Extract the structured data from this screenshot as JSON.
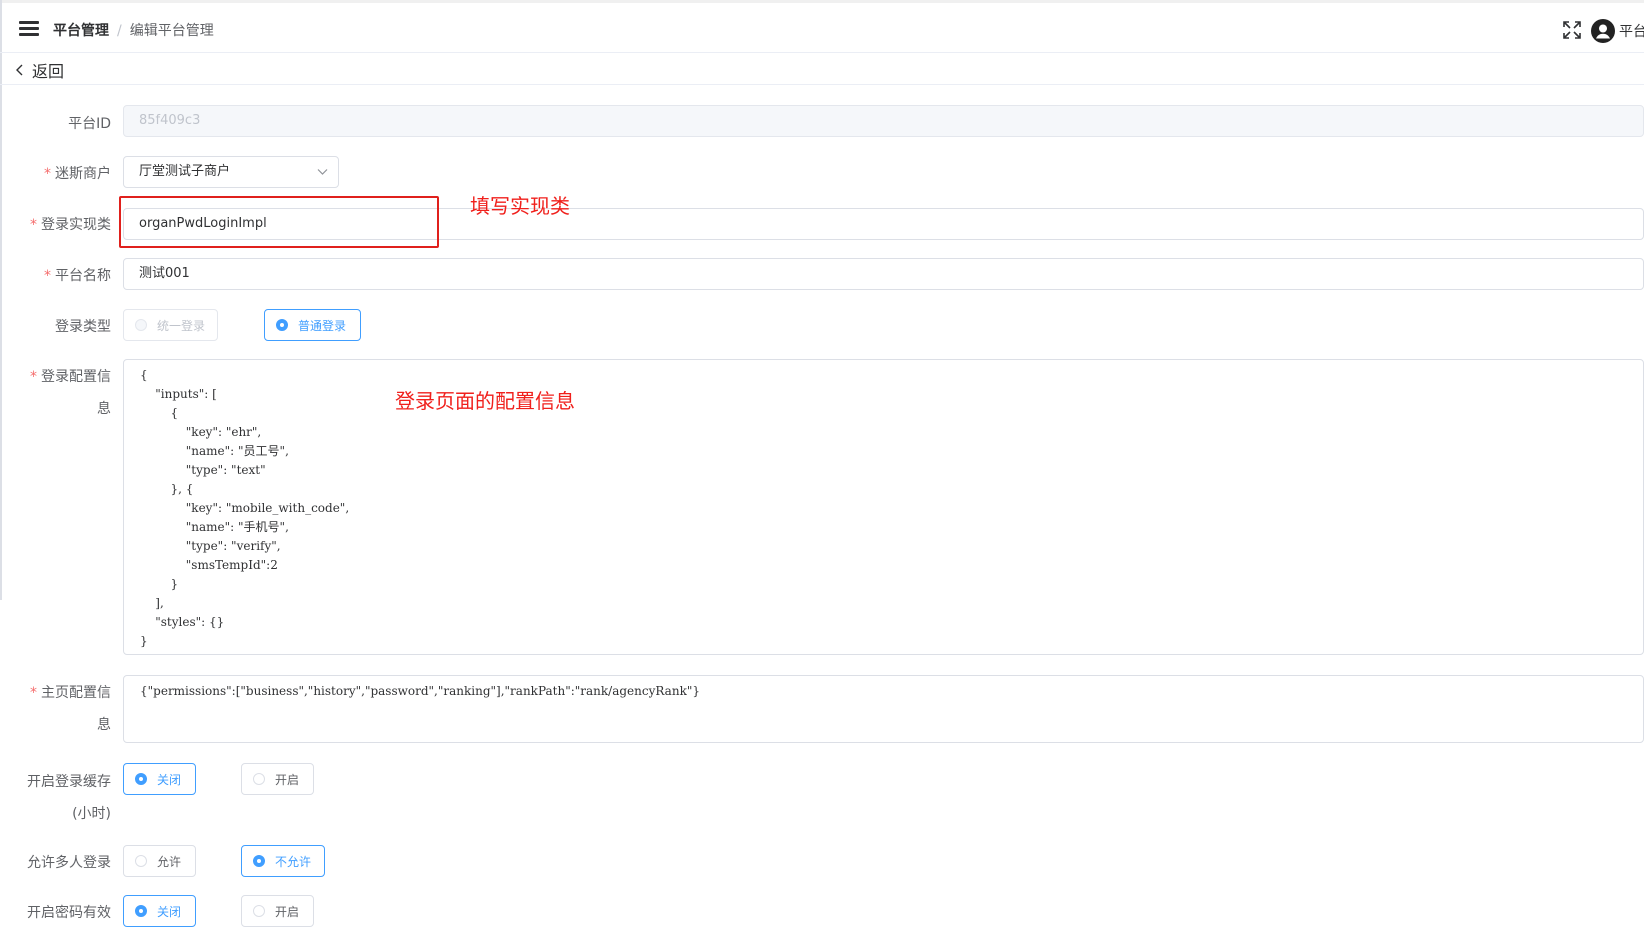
{
  "breadcrumb": {
    "root": "平台管理",
    "separator": "/",
    "current": "编辑平台管理"
  },
  "header": {
    "user_name": "平台"
  },
  "back_label": "返回",
  "form": {
    "platform_id": {
      "label": "平台ID",
      "value": "85f409c3"
    },
    "merchant": {
      "label": "迷斯商户",
      "value": "厅堂测试子商户"
    },
    "login_impl": {
      "label": "登录实现类",
      "value": "organPwdLoginImpl"
    },
    "platform_name": {
      "label": "平台名称",
      "value": "测试001"
    },
    "login_type": {
      "label": "登录类型",
      "options": [
        "统一登录",
        "普通登录"
      ],
      "selected": "普通登录"
    },
    "login_config": {
      "label_line1": "登录配置信",
      "label_line2": "息",
      "value": "{\n    \"inputs\": [\n        {\n            \"key\": \"ehr\",\n            \"name\": \"员工号\",\n            \"type\": \"text\"\n        }, {\n            \"key\": \"mobile_with_code\",\n            \"name\": \"手机号\",\n            \"type\": \"verify\",\n            \"smsTempId\":2\n        }\n    ],\n    \"styles\": {}\n}"
    },
    "home_config": {
      "label_line1": "主页配置信",
      "label_line2": "息",
      "value": "{\"permissions\":[\"business\",\"history\",\"password\",\"ranking\"],\"rankPath\":\"rank/agencyRank\"}"
    },
    "login_cache": {
      "label_line1": "开启登录缓存",
      "label_line2": "(小时)",
      "options": [
        "关闭",
        "开启"
      ],
      "selected": "关闭"
    },
    "multi_login": {
      "label": "允许多人登录",
      "options": [
        "允许",
        "不允许"
      ],
      "selected": "不允许"
    },
    "password_valid": {
      "label": "开启密码有效",
      "options": [
        "关闭",
        "开启"
      ],
      "selected": "关闭"
    }
  },
  "annotations": {
    "impl_note": "填写实现类",
    "config_note": "登录页面的配置信息"
  },
  "colors": {
    "primary": "#409eff",
    "required": "#f56c6c",
    "annotation": "#e0201c"
  },
  "icons": [
    "menu-icon",
    "fullscreen-icon",
    "user-avatar-icon",
    "chevron-left-icon",
    "chevron-down-icon"
  ]
}
